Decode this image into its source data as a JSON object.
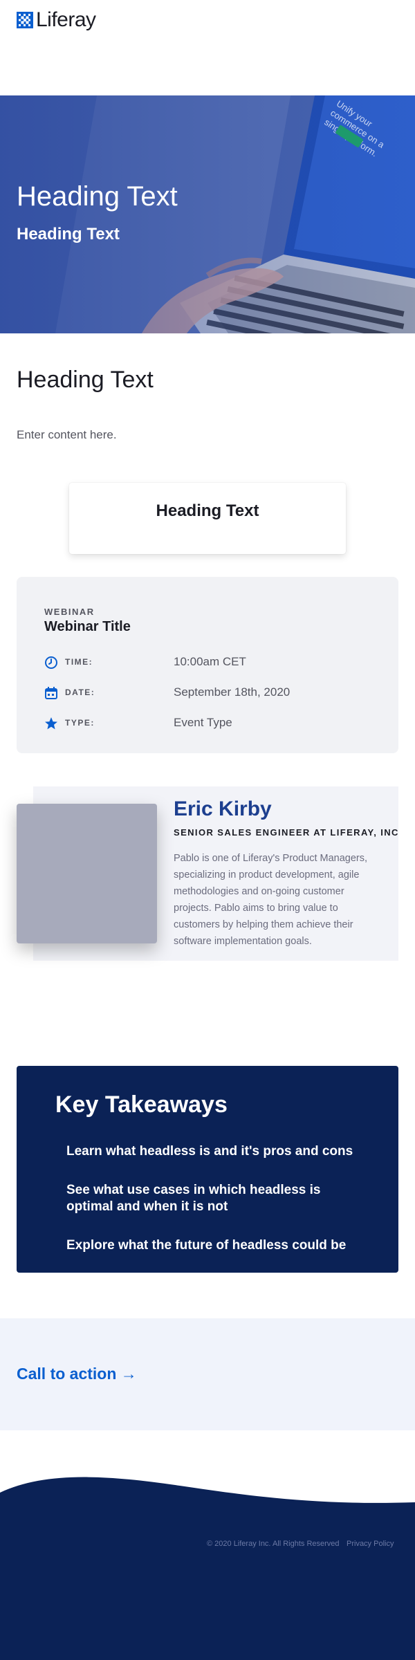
{
  "header": {
    "logo_text": "Liferay"
  },
  "hero": {
    "title": "Heading Text",
    "subtitle": "Heading Text",
    "screen_text": "Unify your commerce on a single platform."
  },
  "section": {
    "heading": "Heading Text",
    "body": "Enter content here."
  },
  "card": {
    "title": "Heading Text"
  },
  "webinar": {
    "eyebrow": "WEBINAR",
    "title": "Webinar Title",
    "rows": [
      {
        "icon": "clock-icon",
        "label": "TIME:",
        "value": "10:00am CET"
      },
      {
        "icon": "calendar-icon",
        "label": "DATE:",
        "value": "September 18th, 2020"
      },
      {
        "icon": "star-icon",
        "label": "TYPE:",
        "value": "Event Type"
      }
    ]
  },
  "speaker": {
    "name": "Eric Kirby",
    "role": "SENIOR SALES ENGINEER AT LIFERAY, INC",
    "bio": "Pablo is one of Liferay's Product Managers, specializing in product development, agile methodologies and on-going customer projects. Pablo aims to bring value to customers by helping them achieve their software implementation goals."
  },
  "takeaways": {
    "title": "Key Takeaways",
    "items": [
      "Learn what headless is and it's pros and cons",
      "See what use cases in which headless is optimal and when it is not",
      "Explore what the future of headless could be"
    ]
  },
  "cta": {
    "label": "Call to action →"
  },
  "footer": {
    "copyright": "© 2020 Liferay Inc. All Rights Reserved",
    "privacy": "Privacy Policy"
  },
  "colors": {
    "brand_blue": "#0b5fcf",
    "navy": "#0b2256",
    "speaker_name": "#1d3f8f"
  }
}
